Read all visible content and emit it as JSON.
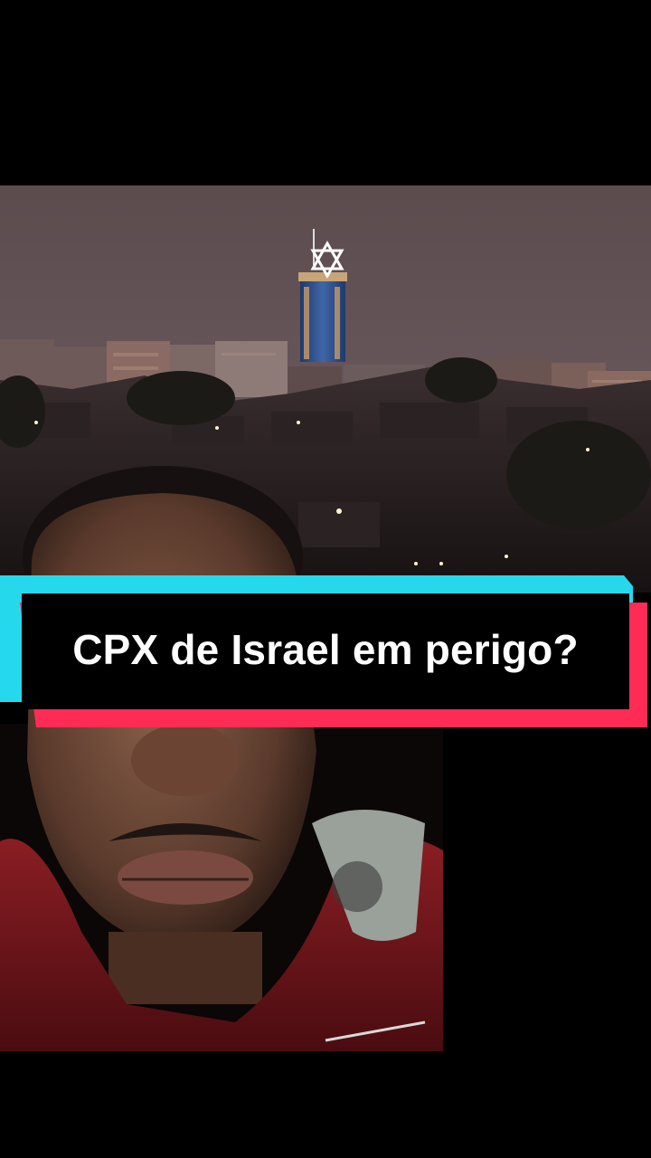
{
  "caption": {
    "text": "CPX de Israel em perigo?"
  },
  "colors": {
    "background": "#000000",
    "caption_box": "#000000",
    "caption_text": "#ffffff",
    "accent_cyan": "#25d8ec",
    "accent_red": "#fe2c55",
    "sky": "#5a4a4c",
    "star": "#ffffff"
  },
  "scene": {
    "description_icon": "city-skyline-with-star-tower"
  }
}
